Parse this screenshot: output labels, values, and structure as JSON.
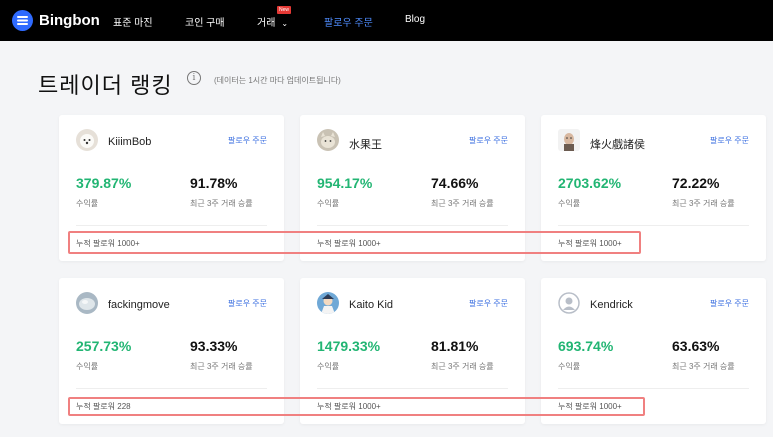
{
  "nav": {
    "brand": "Bingbon",
    "items": [
      "표준 마진",
      "코인 구매",
      "거래",
      "팔로우 주문",
      "Blog"
    ],
    "new_badge": "New",
    "active_item": "팔로우 주문"
  },
  "page": {
    "title": "트레이더 랭킹",
    "info_note": "(데이터는 1시간 마다 업데이트됩니다)"
  },
  "labels": {
    "follow": "팔로우 주문",
    "roi": "수익률",
    "win_rate": "최근 3주 거래 승률"
  },
  "traders": [
    {
      "name": "KiiimBob",
      "roi": "379.87%",
      "win_rate": "91.78%",
      "followers": "누적 팔로워 1000+",
      "avatar": "dog-photo"
    },
    {
      "name": "水果王",
      "roi": "954.17%",
      "win_rate": "74.66%",
      "followers": "누적 팔로워 1000+",
      "avatar": "cat-photo"
    },
    {
      "name": "烽火戲諸侯",
      "roi": "2703.62%",
      "win_rate": "72.22%",
      "followers": "누적 팔로워 1000+",
      "avatar": "person-photo"
    },
    {
      "name": "fackingmove",
      "roi": "257.73%",
      "win_rate": "93.33%",
      "followers": "누적 팔로워 228",
      "avatar": "blob-photo"
    },
    {
      "name": "Kaito Kid",
      "roi": "1479.33%",
      "win_rate": "81.81%",
      "followers": "누적 팔로워 1000+",
      "avatar": "cartoon-photo"
    },
    {
      "name": "Kendrick",
      "roi": "693.74%",
      "win_rate": "63.63%",
      "followers": "누적 팔로워 1000+",
      "avatar": "default-user-icon"
    }
  ],
  "colors": {
    "roi_green": "#22b573",
    "link_blue": "#3b6fe0",
    "highlight": "#f08080",
    "nav_active": "#4f8dff"
  }
}
